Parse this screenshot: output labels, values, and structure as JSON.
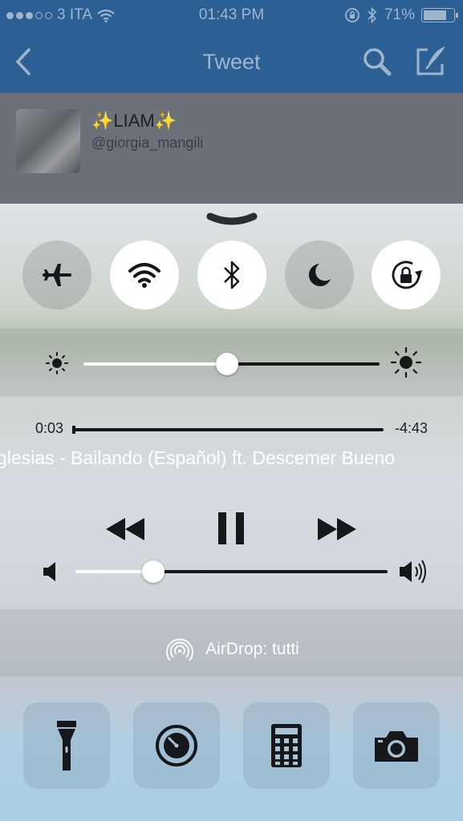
{
  "status_bar": {
    "carrier": "3 ITA",
    "time": "01:43 PM",
    "battery": "71%",
    "battery_level": 0.71
  },
  "nav": {
    "title": "Tweet"
  },
  "tweet": {
    "name": "LIAM",
    "name_prefix": "✨",
    "name_suffix": "✨",
    "handle": "@giorgia_mangili"
  },
  "control_center": {
    "toggles": [
      {
        "name": "airplane-mode",
        "state": "off",
        "icon": "airplane-icon"
      },
      {
        "name": "wifi",
        "state": "on",
        "icon": "wifi-icon"
      },
      {
        "name": "bluetooth",
        "state": "on",
        "icon": "bluetooth-icon"
      },
      {
        "name": "do-not-disturb",
        "state": "off",
        "icon": "moon-icon"
      },
      {
        "name": "rotation-lock",
        "state": "on",
        "icon": "rotation-lock-icon"
      }
    ],
    "brightness": 0.49,
    "media": {
      "elapsed": "0:03",
      "remaining": "-4:43",
      "progress": 0.01,
      "song": "Enrique Iglesias - Bailando (Español) ft. Descemer Bueno",
      "volume": 0.25
    },
    "airdrop": {
      "label": "AirDrop: tutti"
    },
    "tools": [
      {
        "name": "flashlight",
        "icon": "flashlight-icon"
      },
      {
        "name": "timer",
        "icon": "timer-icon"
      },
      {
        "name": "calculator",
        "icon": "calculator-icon"
      },
      {
        "name": "camera",
        "icon": "camera-icon"
      }
    ]
  }
}
